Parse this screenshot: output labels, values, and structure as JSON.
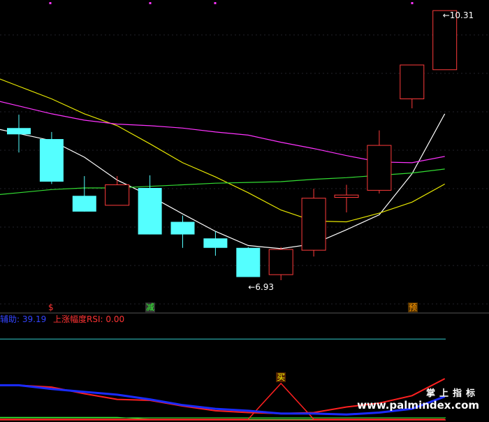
{
  "chart_data": {
    "type": "candlestick",
    "price_axis": {
      "ylim": [
        6.5,
        10.4
      ]
    },
    "candles": [
      {
        "open": 8.82,
        "close": 8.74,
        "high": 8.99,
        "low": 8.51
      },
      {
        "open": 8.68,
        "close": 8.14,
        "high": 8.77,
        "low": 8.11
      },
      {
        "open": 7.96,
        "close": 7.76,
        "high": 8.21,
        "low": 7.76
      },
      {
        "open": 7.84,
        "close": 8.1,
        "high": 8.21,
        "low": 7.84
      },
      {
        "open": 8.06,
        "close": 7.47,
        "high": 8.22,
        "low": 7.47
      },
      {
        "open": 7.63,
        "close": 7.47,
        "high": 7.71,
        "low": 7.3
      },
      {
        "open": 7.42,
        "close": 7.3,
        "high": 7.51,
        "low": 7.2
      },
      {
        "open": 7.3,
        "close": 6.93,
        "high": 7.31,
        "low": 6.93
      },
      {
        "open": 6.96,
        "close": 7.28,
        "high": 7.31,
        "low": 6.89
      },
      {
        "open": 7.27,
        "close": 7.93,
        "high": 8.05,
        "low": 7.19
      },
      {
        "open": 7.94,
        "close": 7.97,
        "high": 8.1,
        "low": 7.75
      },
      {
        "open": 8.03,
        "close": 8.6,
        "high": 8.79,
        "low": 7.99
      },
      {
        "open": 9.19,
        "close": 9.62,
        "high": 9.62,
        "low": 9.07
      },
      {
        "open": 9.56,
        "close": 10.31,
        "high": 10.31,
        "low": 9.56
      }
    ],
    "ma_lines": [
      {
        "color": "#ffffff",
        "values": [
          8.75,
          8.66,
          8.45,
          8.16,
          7.96,
          7.73,
          7.51,
          7.33,
          7.29,
          7.35,
          7.53,
          7.72,
          8.24,
          9.0
        ]
      },
      {
        "color": "#e6e600",
        "values": [
          9.35,
          9.19,
          9.0,
          8.85,
          8.62,
          8.38,
          8.2,
          8.0,
          7.78,
          7.64,
          7.63,
          7.74,
          7.88,
          8.11
        ]
      },
      {
        "color": "#ff33ff",
        "values": [
          9.1,
          9.0,
          8.92,
          8.87,
          8.85,
          8.82,
          8.77,
          8.73,
          8.64,
          8.56,
          8.47,
          8.39,
          8.38,
          8.46
        ]
      },
      {
        "color": "#33dd33",
        "values": [
          8.0,
          8.04,
          8.06,
          8.06,
          8.08,
          8.1,
          8.12,
          8.13,
          8.14,
          8.17,
          8.19,
          8.22,
          8.25,
          8.3
        ]
      }
    ],
    "annotations": [
      {
        "text": "10.31",
        "candle_index": 13,
        "color": "#ffffff"
      },
      {
        "text": "6.93",
        "candle_index": 7,
        "color": "#ffffff"
      }
    ],
    "signals": [
      {
        "text": "$",
        "candle_index": 1,
        "color": "#ff3333"
      },
      {
        "text": "减",
        "candle_index": 4,
        "color": "#33ff33",
        "bg": "#333333"
      },
      {
        "text": "预",
        "candle_index": 12,
        "color": "#ff9900",
        "bg": "#553300"
      }
    ],
    "indicator": {
      "label_blue": "辅助: 39.19",
      "label_red": "上涨幅度RSI: 0.00",
      "buy_text": "买",
      "ylim": [
        0,
        100
      ],
      "upper_level": 85,
      "series_red": [
        36,
        34,
        27,
        21,
        20,
        14,
        9,
        7,
        6,
        7,
        13,
        17,
        25,
        43
      ],
      "series_blue": [
        36,
        32,
        29,
        26,
        21,
        15,
        11,
        9,
        6,
        6,
        5,
        7,
        11,
        24
      ],
      "series_buy": [
        0,
        0,
        0,
        0,
        0,
        0,
        0,
        0,
        38,
        0,
        0,
        0,
        0,
        0
      ],
      "series_green": [
        2,
        2,
        2,
        2,
        0,
        0,
        0,
        0,
        0,
        0,
        0,
        0,
        0,
        0
      ]
    }
  },
  "watermark": {
    "cn": "掌上指标",
    "url": "www.palmindex.com"
  }
}
